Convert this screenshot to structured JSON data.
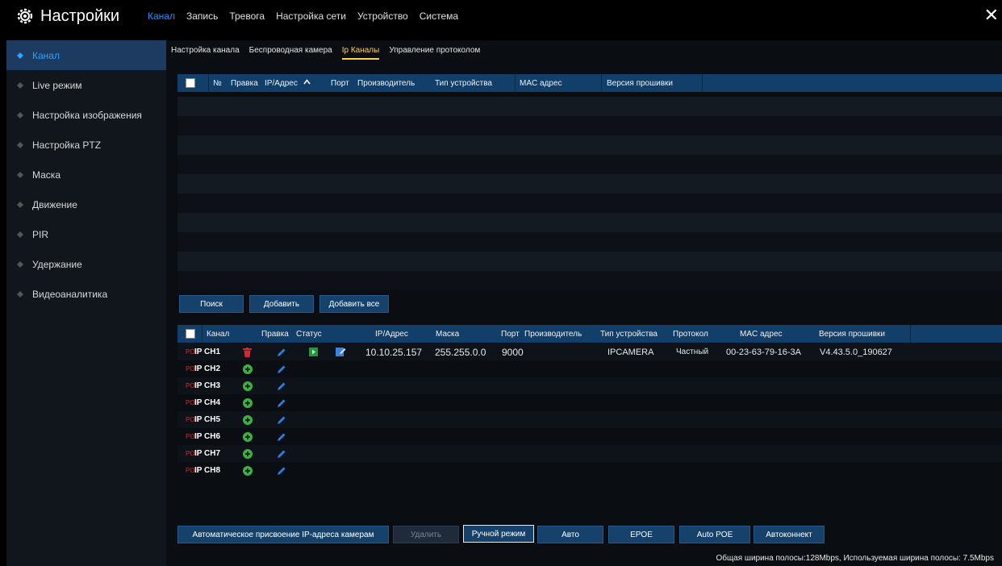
{
  "app": {
    "title": "Настройки",
    "icon": "gear-icon"
  },
  "top_tabs": [
    {
      "label": "Канал",
      "active": true
    },
    {
      "label": "Запись",
      "active": false
    },
    {
      "label": "Тревога",
      "active": false
    },
    {
      "label": "Настройка сети",
      "active": false
    },
    {
      "label": "Устройство",
      "active": false
    },
    {
      "label": "Система",
      "active": false
    }
  ],
  "close_label": "✕",
  "sidebar": {
    "items": [
      {
        "label": "Канал",
        "active": true
      },
      {
        "label": "Live режим",
        "active": false
      },
      {
        "label": "Настройка изображения",
        "active": false
      },
      {
        "label": "Настройка PTZ",
        "active": false
      },
      {
        "label": "Маска",
        "active": false
      },
      {
        "label": "Движение",
        "active": false
      },
      {
        "label": "PIR",
        "active": false
      },
      {
        "label": "Удержание",
        "active": false
      },
      {
        "label": "Видеоаналитика",
        "active": false
      }
    ]
  },
  "sub_tabs": [
    {
      "label": "Настройка канала",
      "active": false
    },
    {
      "label": "Беспроводная камера",
      "active": false
    },
    {
      "label": "Ip Каналы",
      "active": true
    },
    {
      "label": "Управление протоколом",
      "active": false
    }
  ],
  "search_table": {
    "headers": [
      "№",
      "Правка",
      "IP/Адрес",
      "Порт",
      "Производитель",
      "Тип устройства",
      "MAC адрес",
      "Версия прошивки"
    ],
    "sort_indicator": "^"
  },
  "search_buttons": {
    "search": "Поиск",
    "add": "Добавить",
    "add_all": "Добавить все"
  },
  "channel_table": {
    "headers": [
      "Канал",
      "Правка",
      "Статус",
      "IP/Адрес",
      "Маска",
      "Порт",
      "Производитель",
      "Тип устройства",
      "Протокол",
      "MAC адрес",
      "Версия прошивки"
    ],
    "poe_label": "POE",
    "rows": [
      {
        "channel": "IP CH1",
        "configured": true,
        "ip": "10.10.25.157",
        "mask": "255.255.0.0",
        "port": "9000",
        "vendor": "",
        "type": "IPCAMERA",
        "protocol": "Частный",
        "mac": "00-23-63-79-16-3A",
        "firmware": "V4.43.5.0_190627"
      },
      {
        "channel": "IP CH2",
        "configured": false
      },
      {
        "channel": "IP CH3",
        "configured": false
      },
      {
        "channel": "IP CH4",
        "configured": false
      },
      {
        "channel": "IP CH5",
        "configured": false
      },
      {
        "channel": "IP CH6",
        "configured": false
      },
      {
        "channel": "IP CH7",
        "configured": false
      },
      {
        "channel": "IP CH8",
        "configured": false
      }
    ]
  },
  "bottom_buttons": {
    "auto_assign": "Автоматическое присвоение IP-адреса камерам",
    "delete": "Удалить",
    "manual": "Ручной режим",
    "auto": "Авто",
    "epoe": "EPOE",
    "auto_poe": "Auto POE",
    "autoconnect": "Автоконнект"
  },
  "bandwidth_text": "Общая ширина полосы:128Mbps, Используемая ширина полосы: 7.5Mbps",
  "colors": {
    "accent": "#1e90ff",
    "active_subtab": "#ffd34a",
    "header": "#123f6a",
    "poe": "#c43030",
    "add_icon": "#3cb043",
    "edit_icon": "#2f7de1"
  }
}
